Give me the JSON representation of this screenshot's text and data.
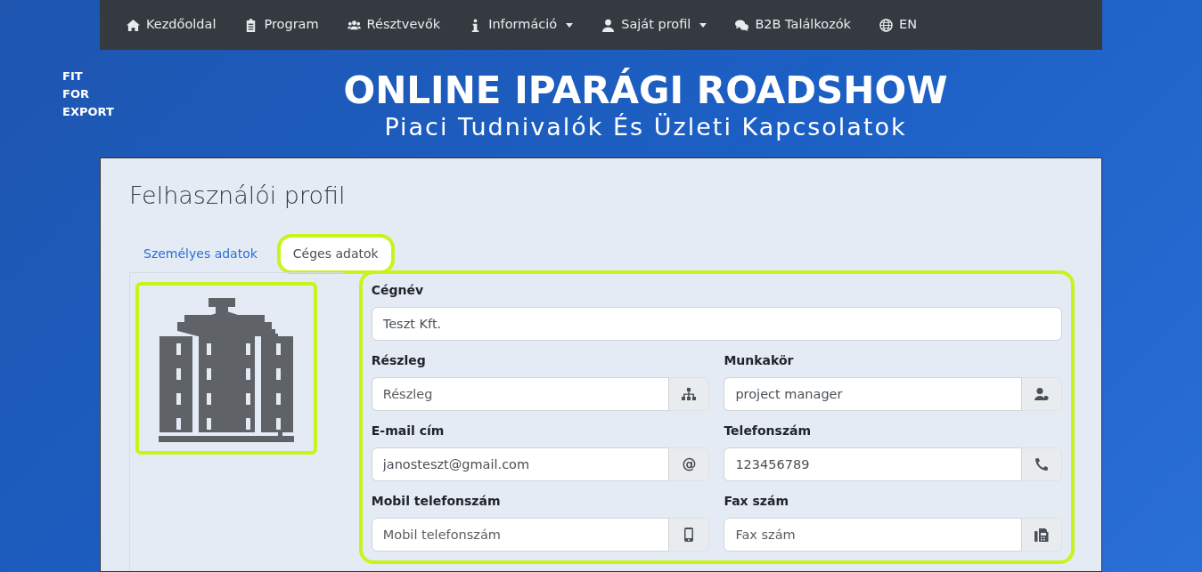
{
  "navbar": {
    "items": [
      {
        "label": "Kezdőoldal",
        "dropdown": false
      },
      {
        "label": "Program",
        "dropdown": false
      },
      {
        "label": "Résztvevők",
        "dropdown": false
      },
      {
        "label": "Információ",
        "dropdown": true
      },
      {
        "label": "Saját profil",
        "dropdown": true
      },
      {
        "label": "B2B Találkozók",
        "dropdown": false
      },
      {
        "label": "EN",
        "dropdown": false
      }
    ]
  },
  "logo": [
    "FIT",
    "FOR",
    "EXPORT"
  ],
  "banner": {
    "title": "ONLINE IPARÁGI ROADSHOW",
    "subtitle": "Piaci Tudnivalók És Üzleti Kapcsolatok"
  },
  "page": {
    "title": "Felhasználói profil",
    "tabs": [
      {
        "label": "Személyes adatok",
        "selected": false,
        "highlighted": false
      },
      {
        "label": "Céges adatok",
        "selected": true,
        "highlighted": true
      }
    ],
    "company_image": {
      "highlighted": true
    },
    "form": {
      "highlighted": true,
      "rows": [
        [
          {
            "label": "Cégnév",
            "value": "Teszt Kft."
          }
        ],
        [
          {
            "label": "Részleg",
            "placeholder": "Részleg",
            "addon": {
              "kind": "icon"
            }
          },
          {
            "label": "Munkakör",
            "value": "project manager",
            "addon": {
              "kind": "icon"
            }
          }
        ],
        [
          {
            "label": "E-mail cím",
            "value": "janosteszt@gmail.com",
            "addon": {
              "kind": "text",
              "text": "@"
            }
          },
          {
            "label": "Telefonszám",
            "value": "123456789",
            "addon": {
              "kind": "icon"
            }
          }
        ],
        [
          {
            "label": "Mobil telefonszám",
            "placeholder": "Mobil telefonszám",
            "addon": {
              "kind": "icon"
            }
          },
          {
            "label": "Fax szám",
            "placeholder": "Fax szám",
            "addon": {
              "kind": "icon"
            }
          }
        ]
      ]
    }
  }
}
